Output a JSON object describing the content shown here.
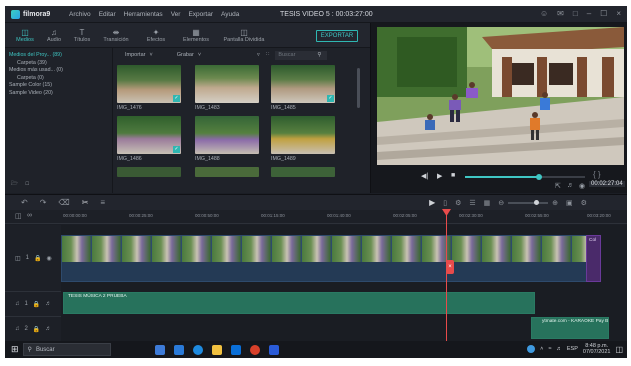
{
  "app": {
    "logo_text": "filmora9",
    "menu": [
      "Archivo",
      "Editar",
      "Herramientas",
      "Ver",
      "Exportar",
      "Ayuda"
    ],
    "window_title": "TESIS VIDEO 5 : 00:03:27:00"
  },
  "tabs": [
    {
      "label": "Medios",
      "icon": "media-icon"
    },
    {
      "label": "Audio",
      "icon": "music-note-icon"
    },
    {
      "label": "Títulos",
      "icon": "text-title-icon"
    },
    {
      "label": "Transición",
      "icon": "transition-icon"
    },
    {
      "label": "Efectos",
      "icon": "effects-icon"
    },
    {
      "label": "Elementos",
      "icon": "elements-icon"
    },
    {
      "label": "Pantalla Dividida",
      "icon": "split-screen-icon"
    }
  ],
  "export_label": "EXPORTAR",
  "media_tree": [
    {
      "label": "Medios del Proy... (89)",
      "selected": true
    },
    {
      "label": "Carpeta (39)",
      "indent": true
    },
    {
      "label": "Medios más usad... (0)",
      "selected": false
    },
    {
      "label": "Carpeta (0)",
      "indent": true
    },
    {
      "label": "Sample Color (15)",
      "selected": false
    },
    {
      "label": "Sample Video (20)",
      "selected": false
    }
  ],
  "toolbar": {
    "import": "Importar",
    "record": "Grabar",
    "search_placeholder": "Buscar"
  },
  "media_items": [
    {
      "name": "IMG_1476",
      "checked": true
    },
    {
      "name": "IMG_1483",
      "checked": false
    },
    {
      "name": "IMG_1485",
      "checked": true
    },
    {
      "name": "IMG_1486",
      "checked": true
    },
    {
      "name": "IMG_1488",
      "checked": false
    },
    {
      "name": "IMG_1489",
      "checked": false
    }
  ],
  "preview": {
    "timecode": "00:02:27:04",
    "progress": 0.62
  },
  "ruler_ticks": [
    "00:00:00:00",
    "00:00:25:00",
    "00:00:50:00",
    "00:01:15:00",
    "00:01:40:00",
    "00:02:05:00",
    "00:02:30:00",
    "00:02:55:00",
    "00:03:20:00"
  ],
  "tracks": [
    {
      "label": "1",
      "type": "video"
    },
    {
      "label": "1",
      "type": "audio"
    },
    {
      "label": "2",
      "type": "audio"
    }
  ],
  "audio_clips": [
    {
      "name": "TESIS MÚSICA 2 PRUEBA"
    },
    {
      "name": "ytmate.com - KARAOKE Pay B"
    }
  ],
  "video_end_label": "Col",
  "taskbar": {
    "search": "Buscar",
    "time": "8:48 p.m.",
    "date": "07/07/2021",
    "lang": "ESP"
  }
}
